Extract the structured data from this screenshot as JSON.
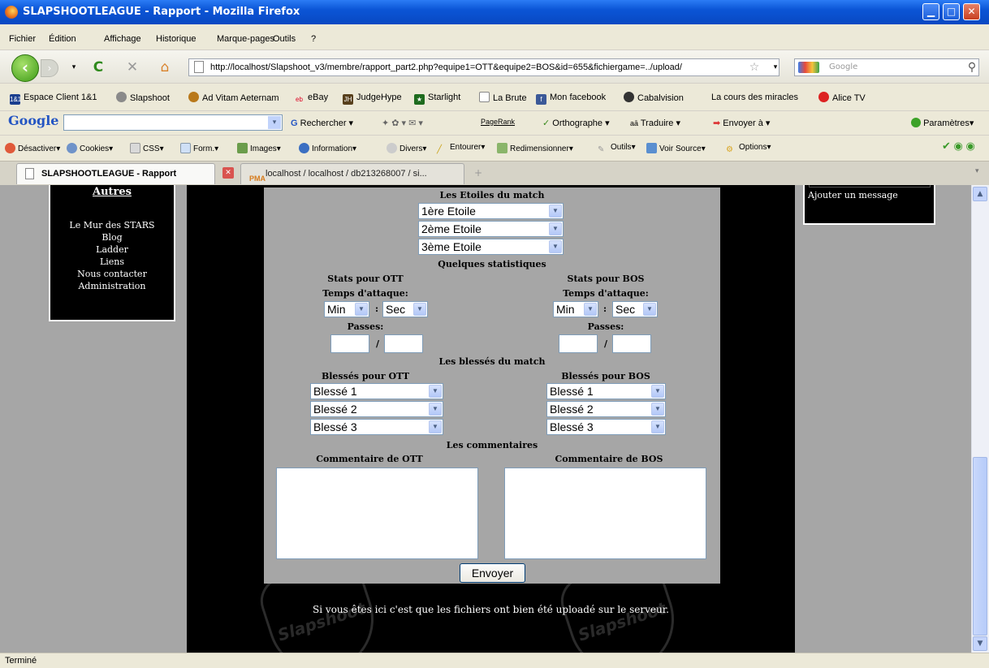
{
  "window": {
    "title": "SLAPSHOOTLEAGUE - Rapport - Mozilla Firefox"
  },
  "menu": [
    "Fichier",
    "Édition",
    "Affichage",
    "Historique",
    "Marque-pages",
    "Outils",
    "?"
  ],
  "url": "http://localhost/Slapshoot_v3/membre/rapport_part2.php?equipe1=OTT&equipe2=BOS&id=655&fichiergame=../upload/",
  "search_placeholder": "Google",
  "bookmarks": [
    "Espace Client 1&1",
    "Slapshoot",
    "Ad Vitam Aeternam",
    "eBay",
    "JudgeHype",
    "Starlight",
    "La Brute",
    "Mon facebook",
    "Cabalvision",
    "La cours des miracles",
    "Alice TV"
  ],
  "googlebar": {
    "logo": "Google",
    "rechercher": "Rechercher",
    "pagerank": "PageRank",
    "orthographe": "Orthographe",
    "traduire": "Traduire",
    "envoyer": "Envoyer à",
    "parametres": "Paramètres"
  },
  "devbar": [
    "Désactiver",
    "Cookies",
    "CSS",
    "Form.",
    "Images",
    "Information",
    "Divers",
    "Entourer",
    "Redimensionner",
    "Outils",
    "Voir Source",
    "Options"
  ],
  "tabs": [
    "SLAPSHOOTLEAGUE - Rapport",
    "localhost / localhost / db213268007 / si..."
  ],
  "sidebar": {
    "heading": "Autres",
    "items": [
      "Le Mur des STARS",
      "Blog",
      "Ladder",
      "Liens",
      "Nous contacter",
      "Administration"
    ]
  },
  "right_panel": {
    "link": "Ajouter un message"
  },
  "form": {
    "stars_title": "Les Etoiles du match",
    "stars": [
      "1ère Etoile",
      "2ème Etoile",
      "3ème Etoile"
    ],
    "stats_title": "Quelques statistiques",
    "team1": {
      "stats_label": "Stats pour OTT",
      "attack_label": "Temps d'attaque:",
      "min": "Min",
      "sec": "Sec",
      "passes_label": "Passes:",
      "injuries_label": "Blessés pour OTT",
      "injured": [
        "Blessé 1",
        "Blessé 2",
        "Blessé 3"
      ],
      "comment_label": "Commentaire de OTT"
    },
    "team2": {
      "stats_label": "Stats pour BOS",
      "attack_label": "Temps d'attaque:",
      "min": "Min",
      "sec": "Sec",
      "passes_label": "Passes:",
      "injuries_label": "Blessés pour BOS",
      "injured": [
        "Blessé 1",
        "Blessé 2",
        "Blessé 3"
      ],
      "comment_label": "Commentaire de BOS"
    },
    "colon": ":",
    "slash": "/",
    "injuries_title": "Les blessés du match",
    "comments_title": "Les commentaires",
    "submit": "Envoyer"
  },
  "notice": "Si vous êtes ici c'est que les fichiers ont bien été uploadé sur le serveur.",
  "watermark": "Slapshoot",
  "status": "Terminé"
}
